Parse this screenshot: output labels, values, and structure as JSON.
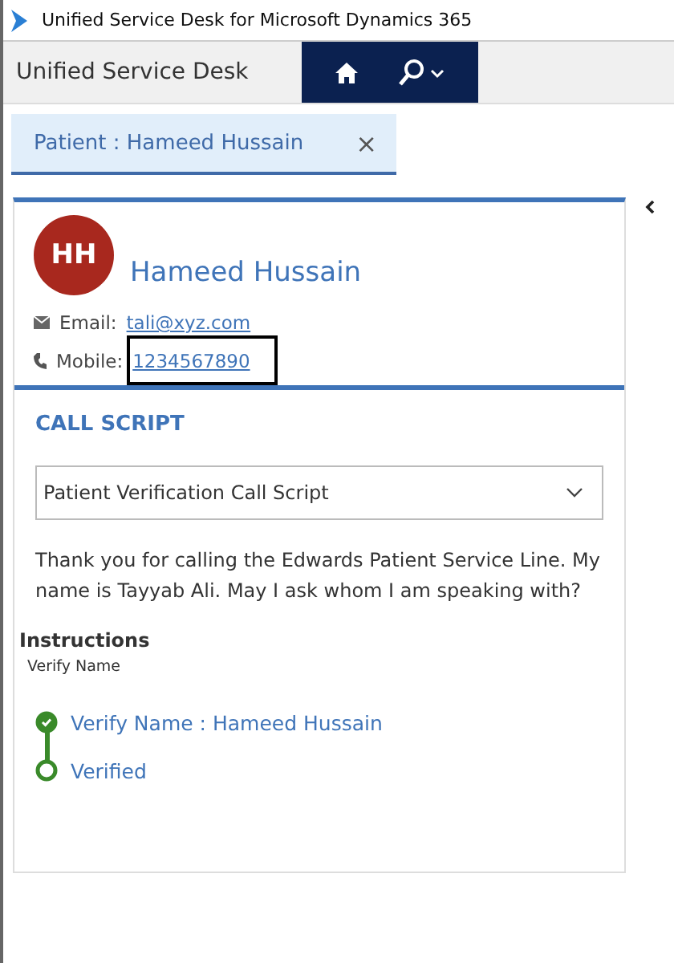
{
  "window": {
    "title": "Unified Service Desk for Microsoft Dynamics 365"
  },
  "nav": {
    "title": "Unified Service Desk"
  },
  "tabs": [
    {
      "label": "Patient : Hameed Hussain",
      "close": "×",
      "selected": true
    }
  ],
  "contact": {
    "initials": "HH",
    "name": "Hameed Hussain",
    "email_label": "Email:",
    "email": "tali@xyz.com",
    "mobile_label": "Mobile:",
    "mobile": "1234567890",
    "mobile_highlighted": true
  },
  "call_script": {
    "heading": "CALL SCRIPT",
    "script": "Patient Verification Call Script",
    "text": "Thank you for calling the Edwards Patient Service Line.  My name is Tayyab Ali. May I ask whom I am speaking with?",
    "instructions_heading": "Instructions",
    "instructions": "Verify Name",
    "steps": [
      {
        "label": "Verify Name : Hameed Hussain",
        "completed": true
      },
      {
        "label": "Verified",
        "completed": false
      }
    ]
  }
}
